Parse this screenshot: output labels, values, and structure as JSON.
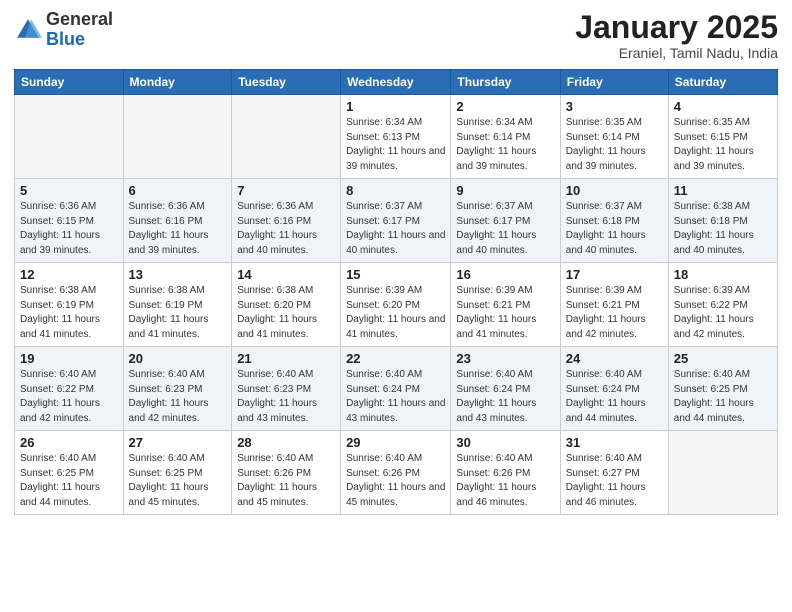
{
  "header": {
    "logo_general": "General",
    "logo_blue": "Blue",
    "title": "January 2025",
    "subtitle": "Eraniel, Tamil Nadu, India"
  },
  "weekdays": [
    "Sunday",
    "Monday",
    "Tuesday",
    "Wednesday",
    "Thursday",
    "Friday",
    "Saturday"
  ],
  "weeks": [
    [
      {
        "day": "",
        "info": ""
      },
      {
        "day": "",
        "info": ""
      },
      {
        "day": "",
        "info": ""
      },
      {
        "day": "1",
        "info": "Sunrise: 6:34 AM\nSunset: 6:13 PM\nDaylight: 11 hours\nand 39 minutes."
      },
      {
        "day": "2",
        "info": "Sunrise: 6:34 AM\nSunset: 6:14 PM\nDaylight: 11 hours\nand 39 minutes."
      },
      {
        "day": "3",
        "info": "Sunrise: 6:35 AM\nSunset: 6:14 PM\nDaylight: 11 hours\nand 39 minutes."
      },
      {
        "day": "4",
        "info": "Sunrise: 6:35 AM\nSunset: 6:15 PM\nDaylight: 11 hours\nand 39 minutes."
      }
    ],
    [
      {
        "day": "5",
        "info": "Sunrise: 6:36 AM\nSunset: 6:15 PM\nDaylight: 11 hours\nand 39 minutes."
      },
      {
        "day": "6",
        "info": "Sunrise: 6:36 AM\nSunset: 6:16 PM\nDaylight: 11 hours\nand 39 minutes."
      },
      {
        "day": "7",
        "info": "Sunrise: 6:36 AM\nSunset: 6:16 PM\nDaylight: 11 hours\nand 40 minutes."
      },
      {
        "day": "8",
        "info": "Sunrise: 6:37 AM\nSunset: 6:17 PM\nDaylight: 11 hours\nand 40 minutes."
      },
      {
        "day": "9",
        "info": "Sunrise: 6:37 AM\nSunset: 6:17 PM\nDaylight: 11 hours\nand 40 minutes."
      },
      {
        "day": "10",
        "info": "Sunrise: 6:37 AM\nSunset: 6:18 PM\nDaylight: 11 hours\nand 40 minutes."
      },
      {
        "day": "11",
        "info": "Sunrise: 6:38 AM\nSunset: 6:18 PM\nDaylight: 11 hours\nand 40 minutes."
      }
    ],
    [
      {
        "day": "12",
        "info": "Sunrise: 6:38 AM\nSunset: 6:19 PM\nDaylight: 11 hours\nand 41 minutes."
      },
      {
        "day": "13",
        "info": "Sunrise: 6:38 AM\nSunset: 6:19 PM\nDaylight: 11 hours\nand 41 minutes."
      },
      {
        "day": "14",
        "info": "Sunrise: 6:38 AM\nSunset: 6:20 PM\nDaylight: 11 hours\nand 41 minutes."
      },
      {
        "day": "15",
        "info": "Sunrise: 6:39 AM\nSunset: 6:20 PM\nDaylight: 11 hours\nand 41 minutes."
      },
      {
        "day": "16",
        "info": "Sunrise: 6:39 AM\nSunset: 6:21 PM\nDaylight: 11 hours\nand 41 minutes."
      },
      {
        "day": "17",
        "info": "Sunrise: 6:39 AM\nSunset: 6:21 PM\nDaylight: 11 hours\nand 42 minutes."
      },
      {
        "day": "18",
        "info": "Sunrise: 6:39 AM\nSunset: 6:22 PM\nDaylight: 11 hours\nand 42 minutes."
      }
    ],
    [
      {
        "day": "19",
        "info": "Sunrise: 6:40 AM\nSunset: 6:22 PM\nDaylight: 11 hours\nand 42 minutes."
      },
      {
        "day": "20",
        "info": "Sunrise: 6:40 AM\nSunset: 6:23 PM\nDaylight: 11 hours\nand 42 minutes."
      },
      {
        "day": "21",
        "info": "Sunrise: 6:40 AM\nSunset: 6:23 PM\nDaylight: 11 hours\nand 43 minutes."
      },
      {
        "day": "22",
        "info": "Sunrise: 6:40 AM\nSunset: 6:24 PM\nDaylight: 11 hours\nand 43 minutes."
      },
      {
        "day": "23",
        "info": "Sunrise: 6:40 AM\nSunset: 6:24 PM\nDaylight: 11 hours\nand 43 minutes."
      },
      {
        "day": "24",
        "info": "Sunrise: 6:40 AM\nSunset: 6:24 PM\nDaylight: 11 hours\nand 44 minutes."
      },
      {
        "day": "25",
        "info": "Sunrise: 6:40 AM\nSunset: 6:25 PM\nDaylight: 11 hours\nand 44 minutes."
      }
    ],
    [
      {
        "day": "26",
        "info": "Sunrise: 6:40 AM\nSunset: 6:25 PM\nDaylight: 11 hours\nand 44 minutes."
      },
      {
        "day": "27",
        "info": "Sunrise: 6:40 AM\nSunset: 6:25 PM\nDaylight: 11 hours\nand 45 minutes."
      },
      {
        "day": "28",
        "info": "Sunrise: 6:40 AM\nSunset: 6:26 PM\nDaylight: 11 hours\nand 45 minutes."
      },
      {
        "day": "29",
        "info": "Sunrise: 6:40 AM\nSunset: 6:26 PM\nDaylight: 11 hours\nand 45 minutes."
      },
      {
        "day": "30",
        "info": "Sunrise: 6:40 AM\nSunset: 6:26 PM\nDaylight: 11 hours\nand 46 minutes."
      },
      {
        "day": "31",
        "info": "Sunrise: 6:40 AM\nSunset: 6:27 PM\nDaylight: 11 hours\nand 46 minutes."
      },
      {
        "day": "",
        "info": ""
      }
    ]
  ]
}
